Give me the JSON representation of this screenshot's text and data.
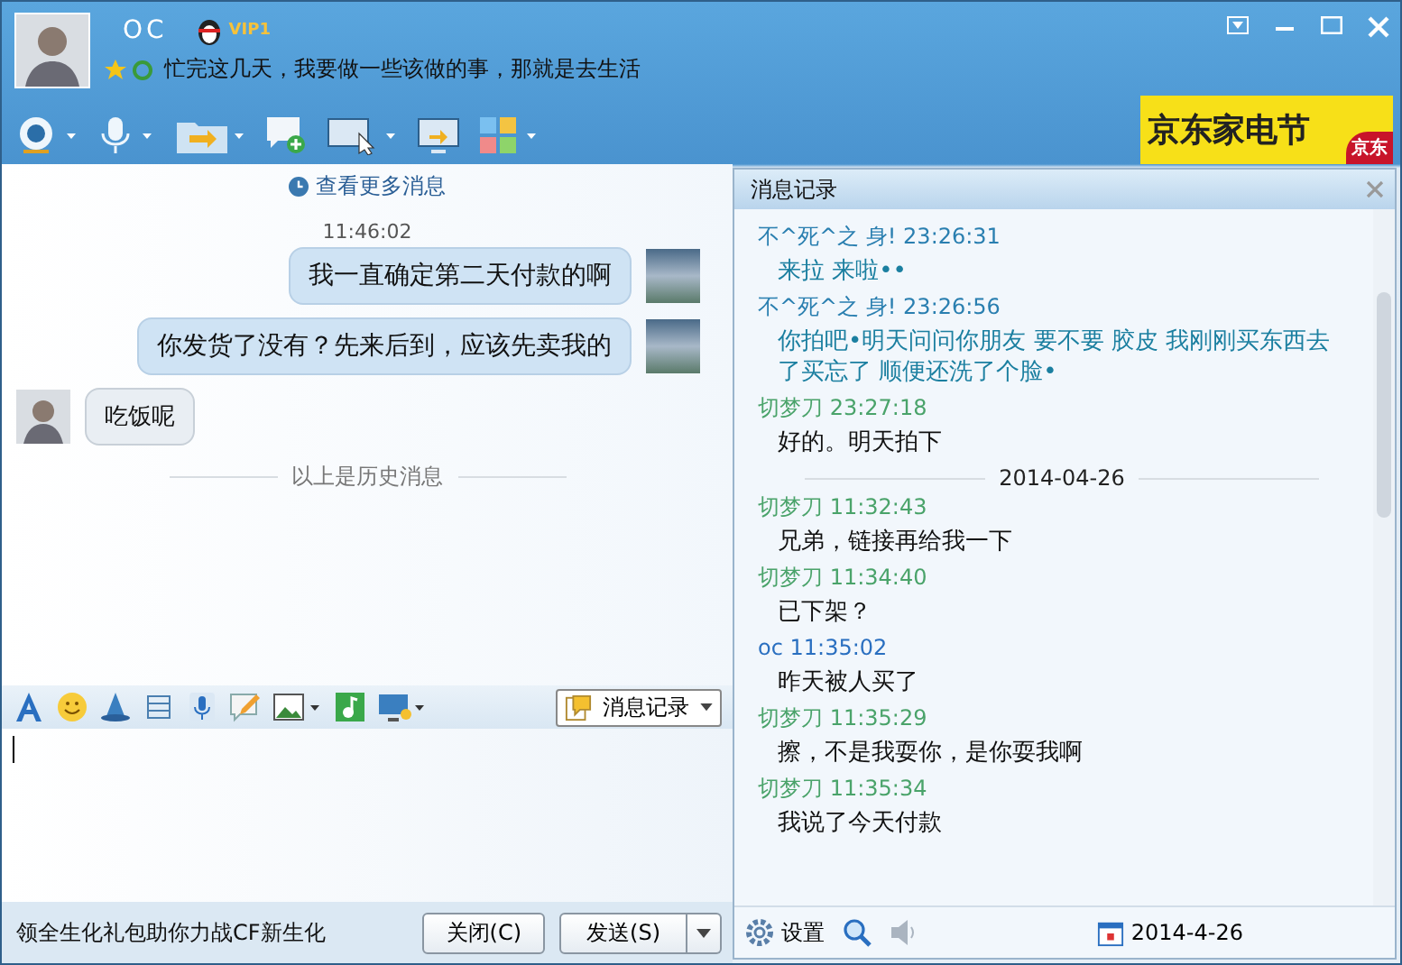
{
  "contact": {
    "name": "OC",
    "badge": "VIP1",
    "status": "忙完这几天，我要做一些该做的事，那就是去生活"
  },
  "ad": {
    "title": "京东家电节",
    "tag": "京东"
  },
  "chat": {
    "more_link": "查看更多消息",
    "time": "11:46:02",
    "messages": [
      {
        "kind": "outgoing",
        "text": "我一直确定第二天付款的啊"
      },
      {
        "kind": "outgoing",
        "text": "你发货了没有？先来后到，应该先卖我的"
      },
      {
        "kind": "incoming",
        "text": "吃饭呢"
      }
    ],
    "history_divider": "以上是历史消息"
  },
  "input_toolbar": {
    "history_button": "消息记录"
  },
  "footer": {
    "promo": "领全生化礼包助你力战CF新生化",
    "close_button": "关闭(C)",
    "send_button": "发送(S)"
  },
  "history_panel": {
    "title": "消息记录",
    "entries": [
      {
        "kind": "peer",
        "sender": "不^死^之 身! 23:26:31",
        "text": "来拉  来啦••"
      },
      {
        "kind": "peer",
        "sender": "不^死^之 身! 23:26:56",
        "text": "你拍吧•明天问问你朋友  要不要  胶皮  我刚刚买东西去了买忘了  顺便还洗了个脸•"
      },
      {
        "kind": "self",
        "sender": "切梦刀 23:27:18",
        "text": "好的。明天拍下"
      },
      {
        "kind": "date",
        "text": "2014-04-26"
      },
      {
        "kind": "self",
        "sender": "切梦刀 11:32:43",
        "text": "兄弟，链接再给我一下"
      },
      {
        "kind": "self",
        "sender": "切梦刀 11:34:40",
        "text": "已下架？"
      },
      {
        "kind": "contact",
        "sender": "oc 11:35:02",
        "text": "昨天被人买了"
      },
      {
        "kind": "self",
        "sender": "切梦刀 11:35:29",
        "text": "擦，不是我耍你，是你耍我啊"
      },
      {
        "kind": "self",
        "sender": "切梦刀 11:35:34",
        "text": "我说了今天付款"
      }
    ],
    "settings": "设置",
    "date": "2014-4-26"
  }
}
